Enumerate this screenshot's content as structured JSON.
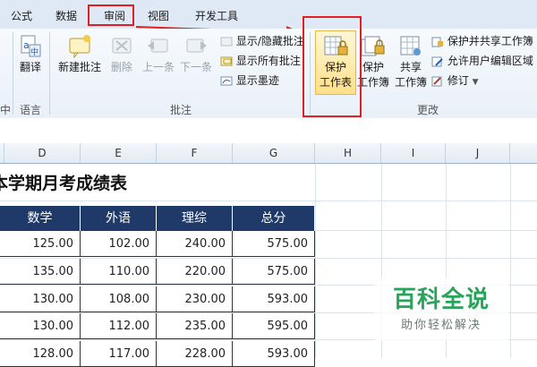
{
  "tabs": [
    "公式",
    "数据",
    "审阅",
    "视图",
    "开发工具"
  ],
  "active_tab": "审阅",
  "groups": {
    "language": {
      "label": "语言",
      "translate": "翻译"
    },
    "comments": {
      "label": "批注",
      "new_comment": "新建批注",
      "delete": "删除",
      "previous": "上一条",
      "next": "下一条",
      "show_hide_comment": "显示/隐藏批注",
      "show_all_comments": "显示所有批注",
      "show_ink": "显示墨迹"
    },
    "changes": {
      "label": "更改",
      "protect_sheet": [
        "保护",
        "工作表"
      ],
      "protect_workbook": [
        "保护",
        "工作簿"
      ],
      "share_workbook": [
        "共享",
        "工作簿"
      ],
      "protect_and_share": "保护并共享工作簿",
      "allow_edit_ranges": "允许用户编辑区域",
      "track_changes": "修订"
    }
  },
  "sheet": {
    "columns": [
      "D",
      "E",
      "F",
      "G",
      "H",
      "I",
      "J"
    ],
    "title": "本学期月考成绩表",
    "headers": [
      "数学",
      "外语",
      "理综",
      "总分"
    ],
    "rows": [
      [
        "125.00",
        "102.00",
        "240.00",
        "575.00"
      ],
      [
        "135.00",
        "110.00",
        "220.00",
        "575.00"
      ],
      [
        "130.00",
        "108.00",
        "230.00",
        "593.00"
      ],
      [
        "130.00",
        "112.00",
        "235.00",
        "595.00"
      ],
      [
        "128.00",
        "117.00",
        "228.00",
        "593.00"
      ]
    ]
  },
  "watermark": {
    "title": "百科全说",
    "subtitle": "助你轻松解决"
  },
  "colors": {
    "highlight": "#e02020",
    "header_fill": "#1f3a68",
    "watermark": "#2aa35a"
  }
}
